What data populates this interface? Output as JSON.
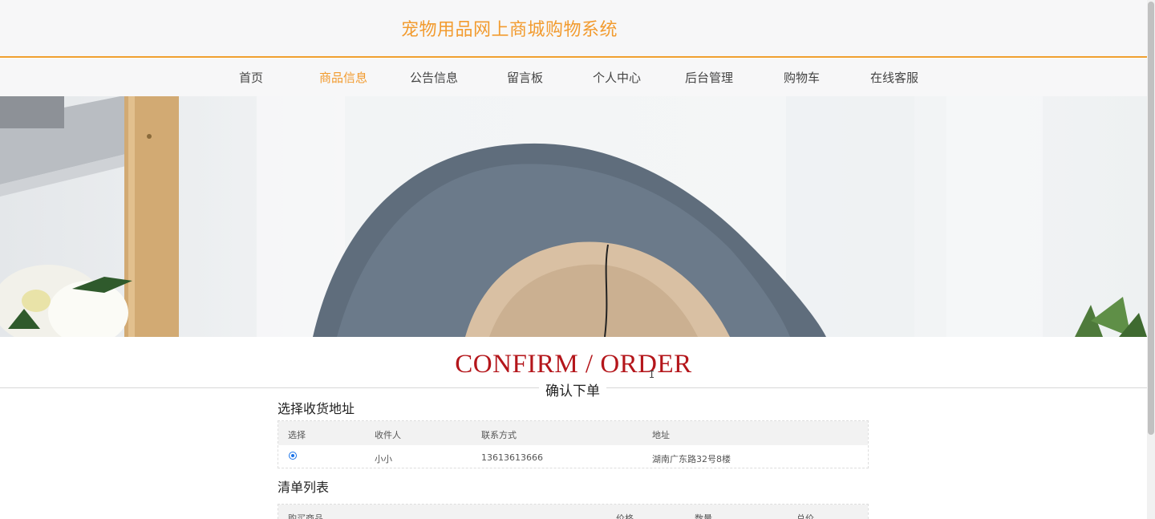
{
  "site": {
    "title": "宠物用品网上商城购物系统"
  },
  "nav": {
    "items": [
      {
        "label": "首页",
        "active": false
      },
      {
        "label": "商品信息",
        "active": true
      },
      {
        "label": "公告信息",
        "active": false
      },
      {
        "label": "留言板",
        "active": false
      },
      {
        "label": "个人中心",
        "active": false
      },
      {
        "label": "后台管理",
        "active": false
      },
      {
        "label": "购物车",
        "active": false
      },
      {
        "label": "在线客服",
        "active": false
      }
    ]
  },
  "banner": {
    "subject": "pet-bed-photo"
  },
  "header": {
    "title_en": "CONFIRM / ORDER",
    "title_cn": "确认下单"
  },
  "address_section": {
    "title": "选择收货地址",
    "columns": [
      "选择",
      "收件人",
      "联系方式",
      "地址"
    ],
    "rows": [
      {
        "selected": true,
        "recipient": "小小",
        "phone": "13613613666",
        "address": "湖南广东路32号8楼"
      }
    ]
  },
  "list_section": {
    "title": "清单列表",
    "columns": [
      "购买商品",
      "价格",
      "数量",
      "总价"
    ]
  },
  "colors": {
    "accent": "#f29b2f",
    "title_red": "#b4161b",
    "radio": "#1a73e8"
  }
}
